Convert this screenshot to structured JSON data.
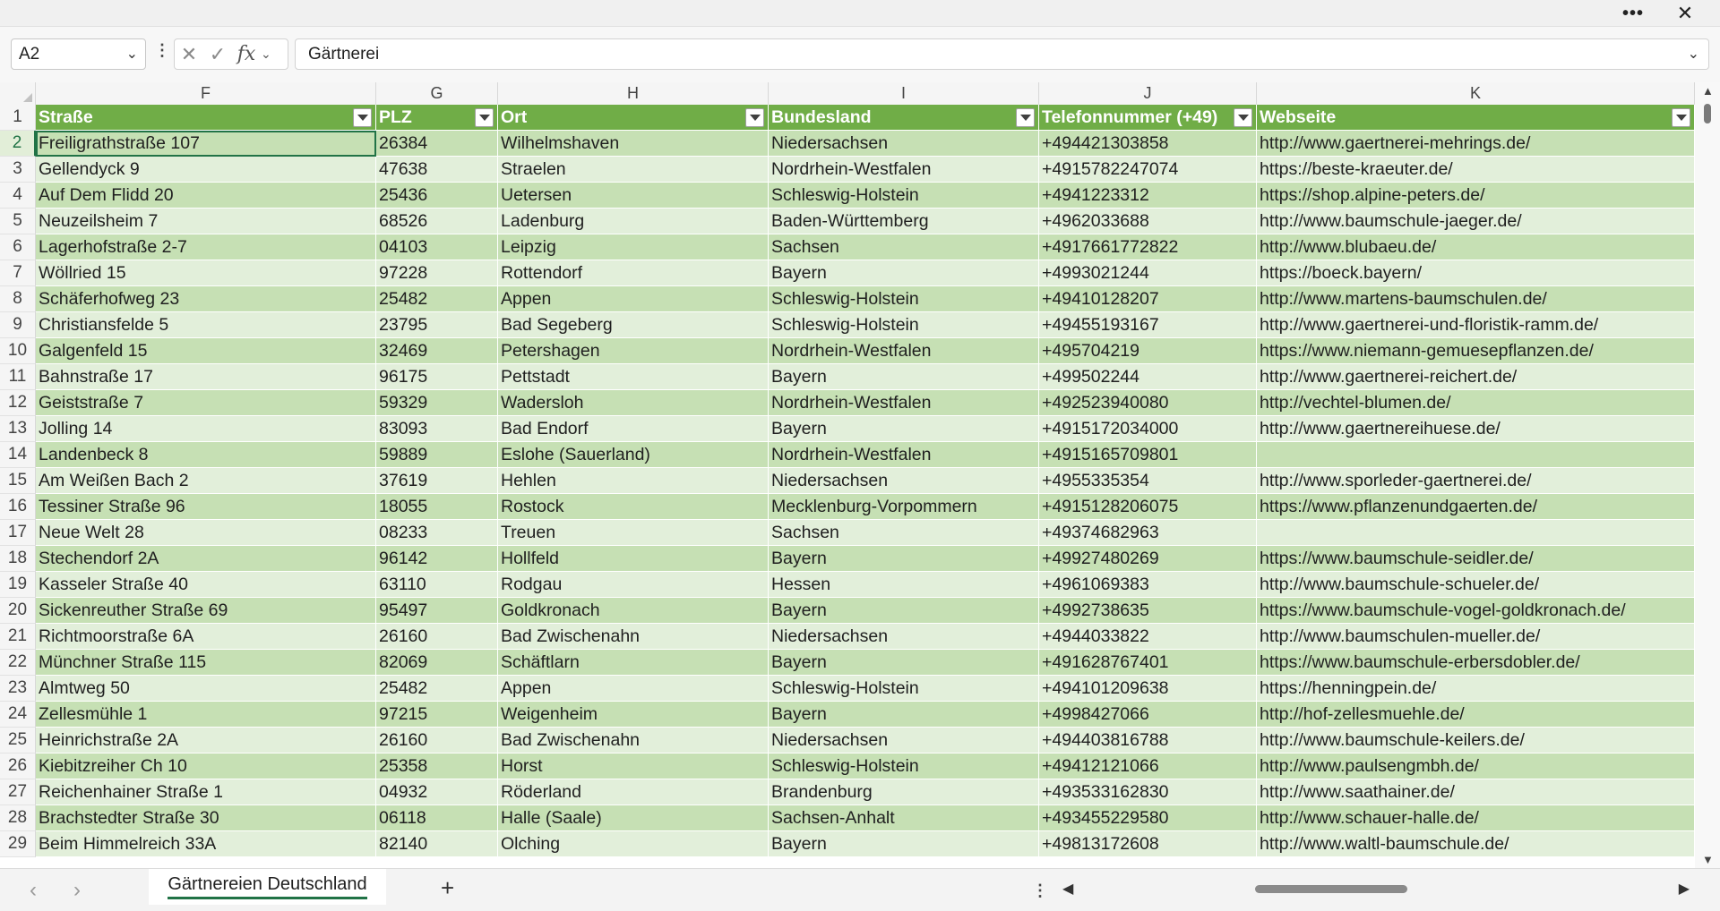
{
  "window": {
    "more_icon": "ellipsis-icon",
    "close_icon": "close-icon"
  },
  "formula_bar": {
    "name_box": "A2",
    "formula": "Gärtnerei",
    "fx_label": "fx"
  },
  "columns": [
    {
      "letter": "F"
    },
    {
      "letter": "G"
    },
    {
      "letter": "H"
    },
    {
      "letter": "I"
    },
    {
      "letter": "J"
    },
    {
      "letter": "K"
    }
  ],
  "header_row": {
    "row_number": "1",
    "cells": [
      "Straße",
      "PLZ",
      "Ort",
      "Bundesland",
      "Telefonnummer (+49)",
      "Webseite"
    ]
  },
  "rows": [
    {
      "n": "2",
      "cells": [
        "Freiligrathstraße 107",
        "26384",
        "Wilhelmshaven",
        "Niedersachsen",
        "+494421303858",
        "http://www.gaertnerei-mehrings.de/"
      ]
    },
    {
      "n": "3",
      "cells": [
        "Gellendyck 9",
        "47638",
        "Straelen",
        "Nordrhein-Westfalen",
        "+4915782247074",
        "https://beste-kraeuter.de/"
      ]
    },
    {
      "n": "4",
      "cells": [
        "Auf Dem Flidd 20",
        "25436",
        "Uetersen",
        "Schleswig-Holstein",
        "+4941223312",
        "https://shop.alpine-peters.de/"
      ]
    },
    {
      "n": "5",
      "cells": [
        "Neuzeilsheim 7",
        "68526",
        "Ladenburg",
        "Baden-Württemberg",
        "+4962033688",
        "http://www.baumschule-jaeger.de/"
      ]
    },
    {
      "n": "6",
      "cells": [
        "Lagerhofstraße 2-7",
        "04103",
        "Leipzig",
        "Sachsen",
        "+4917661772822",
        "http://www.blubaeu.de/"
      ]
    },
    {
      "n": "7",
      "cells": [
        "Wöllried 15",
        "97228",
        "Rottendorf",
        "Bayern",
        "+4993021244",
        "https://boeck.bayern/"
      ]
    },
    {
      "n": "8",
      "cells": [
        "Schäferhofweg 23",
        "25482",
        "Appen",
        "Schleswig-Holstein",
        "+49410128207",
        "http://www.martens-baumschulen.de/"
      ]
    },
    {
      "n": "9",
      "cells": [
        "Christiansfelde 5",
        "23795",
        "Bad Segeberg",
        "Schleswig-Holstein",
        "+49455193167",
        "http://www.gaertnerei-und-floristik-ramm.de/"
      ]
    },
    {
      "n": "10",
      "cells": [
        "Galgenfeld 15",
        "32469",
        "Petershagen",
        "Nordrhein-Westfalen",
        "+495704219",
        "https://www.niemann-gemuesepflanzen.de/"
      ]
    },
    {
      "n": "11",
      "cells": [
        "Bahnstraße 17",
        "96175",
        "Pettstadt",
        "Bayern",
        "+499502244",
        "http://www.gaertnerei-reichert.de/"
      ]
    },
    {
      "n": "12",
      "cells": [
        "Geiststraße 7",
        "59329",
        "Wadersloh",
        "Nordrhein-Westfalen",
        "+492523940080",
        "http://vechtel-blumen.de/"
      ]
    },
    {
      "n": "13",
      "cells": [
        "Jolling 14",
        "83093",
        "Bad Endorf",
        "Bayern",
        "+4915172034000",
        "http://www.gaertnereihuese.de/"
      ]
    },
    {
      "n": "14",
      "cells": [
        "Landenbeck 8",
        "59889",
        "Eslohe (Sauerland)",
        "Nordrhein-Westfalen",
        "+4915165709801",
        ""
      ]
    },
    {
      "n": "15",
      "cells": [
        "Am Weißen Bach 2",
        "37619",
        "Hehlen",
        "Niedersachsen",
        "+4955335354",
        "http://www.sporleder-gaertnerei.de/"
      ]
    },
    {
      "n": "16",
      "cells": [
        "Tessiner Straße 96",
        "18055",
        "Rostock",
        "Mecklenburg-Vorpommern",
        "+4915128206075",
        "https://www.pflanzenundgaerten.de/"
      ]
    },
    {
      "n": "17",
      "cells": [
        "Neue Welt 28",
        "08233",
        "Treuen",
        "Sachsen",
        "+49374682963",
        ""
      ]
    },
    {
      "n": "18",
      "cells": [
        "Stechendorf 2A",
        "96142",
        "Hollfeld",
        "Bayern",
        "+49927480269",
        "https://www.baumschule-seidler.de/"
      ]
    },
    {
      "n": "19",
      "cells": [
        "Kasseler Straße 40",
        "63110",
        "Rodgau",
        "Hessen",
        "+4961069383",
        "http://www.baumschule-schueler.de/"
      ]
    },
    {
      "n": "20",
      "cells": [
        "Sickenreuther Straße 69",
        "95497",
        "Goldkronach",
        "Bayern",
        "+4992738635",
        "https://www.baumschule-vogel-goldkronach.de/"
      ]
    },
    {
      "n": "21",
      "cells": [
        "Richtmoorstraße 6A",
        "26160",
        "Bad Zwischenahn",
        "Niedersachsen",
        "+4944033822",
        "http://www.baumschulen-mueller.de/"
      ]
    },
    {
      "n": "22",
      "cells": [
        "Münchner Straße 115",
        "82069",
        "Schäftlarn",
        "Bayern",
        "+491628767401",
        "https://www.baumschule-erbersdobler.de/"
      ]
    },
    {
      "n": "23",
      "cells": [
        "Almtweg 50",
        "25482",
        "Appen",
        "Schleswig-Holstein",
        "+494101209638",
        "https://henningpein.de/"
      ]
    },
    {
      "n": "24",
      "cells": [
        "Zellesmühle 1",
        "97215",
        "Weigenheim",
        "Bayern",
        "+4998427066",
        "http://hof-zellesmuehle.de/"
      ]
    },
    {
      "n": "25",
      "cells": [
        "Heinrichstraße 2A",
        "26160",
        "Bad Zwischenahn",
        "Niedersachsen",
        "+494403816788",
        "http://www.baumschule-keilers.de/"
      ]
    },
    {
      "n": "26",
      "cells": [
        "Kiebitzreiher Ch 10",
        "25358",
        "Horst",
        "Schleswig-Holstein",
        "+49412121066",
        "http://www.paulsengmbh.de/"
      ]
    },
    {
      "n": "27",
      "cells": [
        "Reichenhainer Straße 1",
        "04932",
        "Röderland",
        "Brandenburg",
        "+493533162830",
        "http://www.saathainer.de/"
      ]
    },
    {
      "n": "28",
      "cells": [
        "Brachstedter Straße 30",
        "06118",
        "Halle (Saale)",
        "Sachsen-Anhalt",
        "+493455229580",
        "http://www.schauer-halle.de/"
      ]
    },
    {
      "n": "29",
      "cells": [
        "Beim Himmelreich 33A",
        "82140",
        "Olching",
        "Bayern",
        "+49813172608",
        "http://www.waltl-baumschule.de/"
      ]
    }
  ],
  "sheet_tabs": [
    {
      "label": "Gärtnereien Deutschland",
      "active": true
    }
  ],
  "add_sheet_label": "+",
  "colors": {
    "header_green": "#70ad47",
    "band_dark": "#c6e0b4",
    "band_light": "#e2efda",
    "accent": "#217346"
  }
}
